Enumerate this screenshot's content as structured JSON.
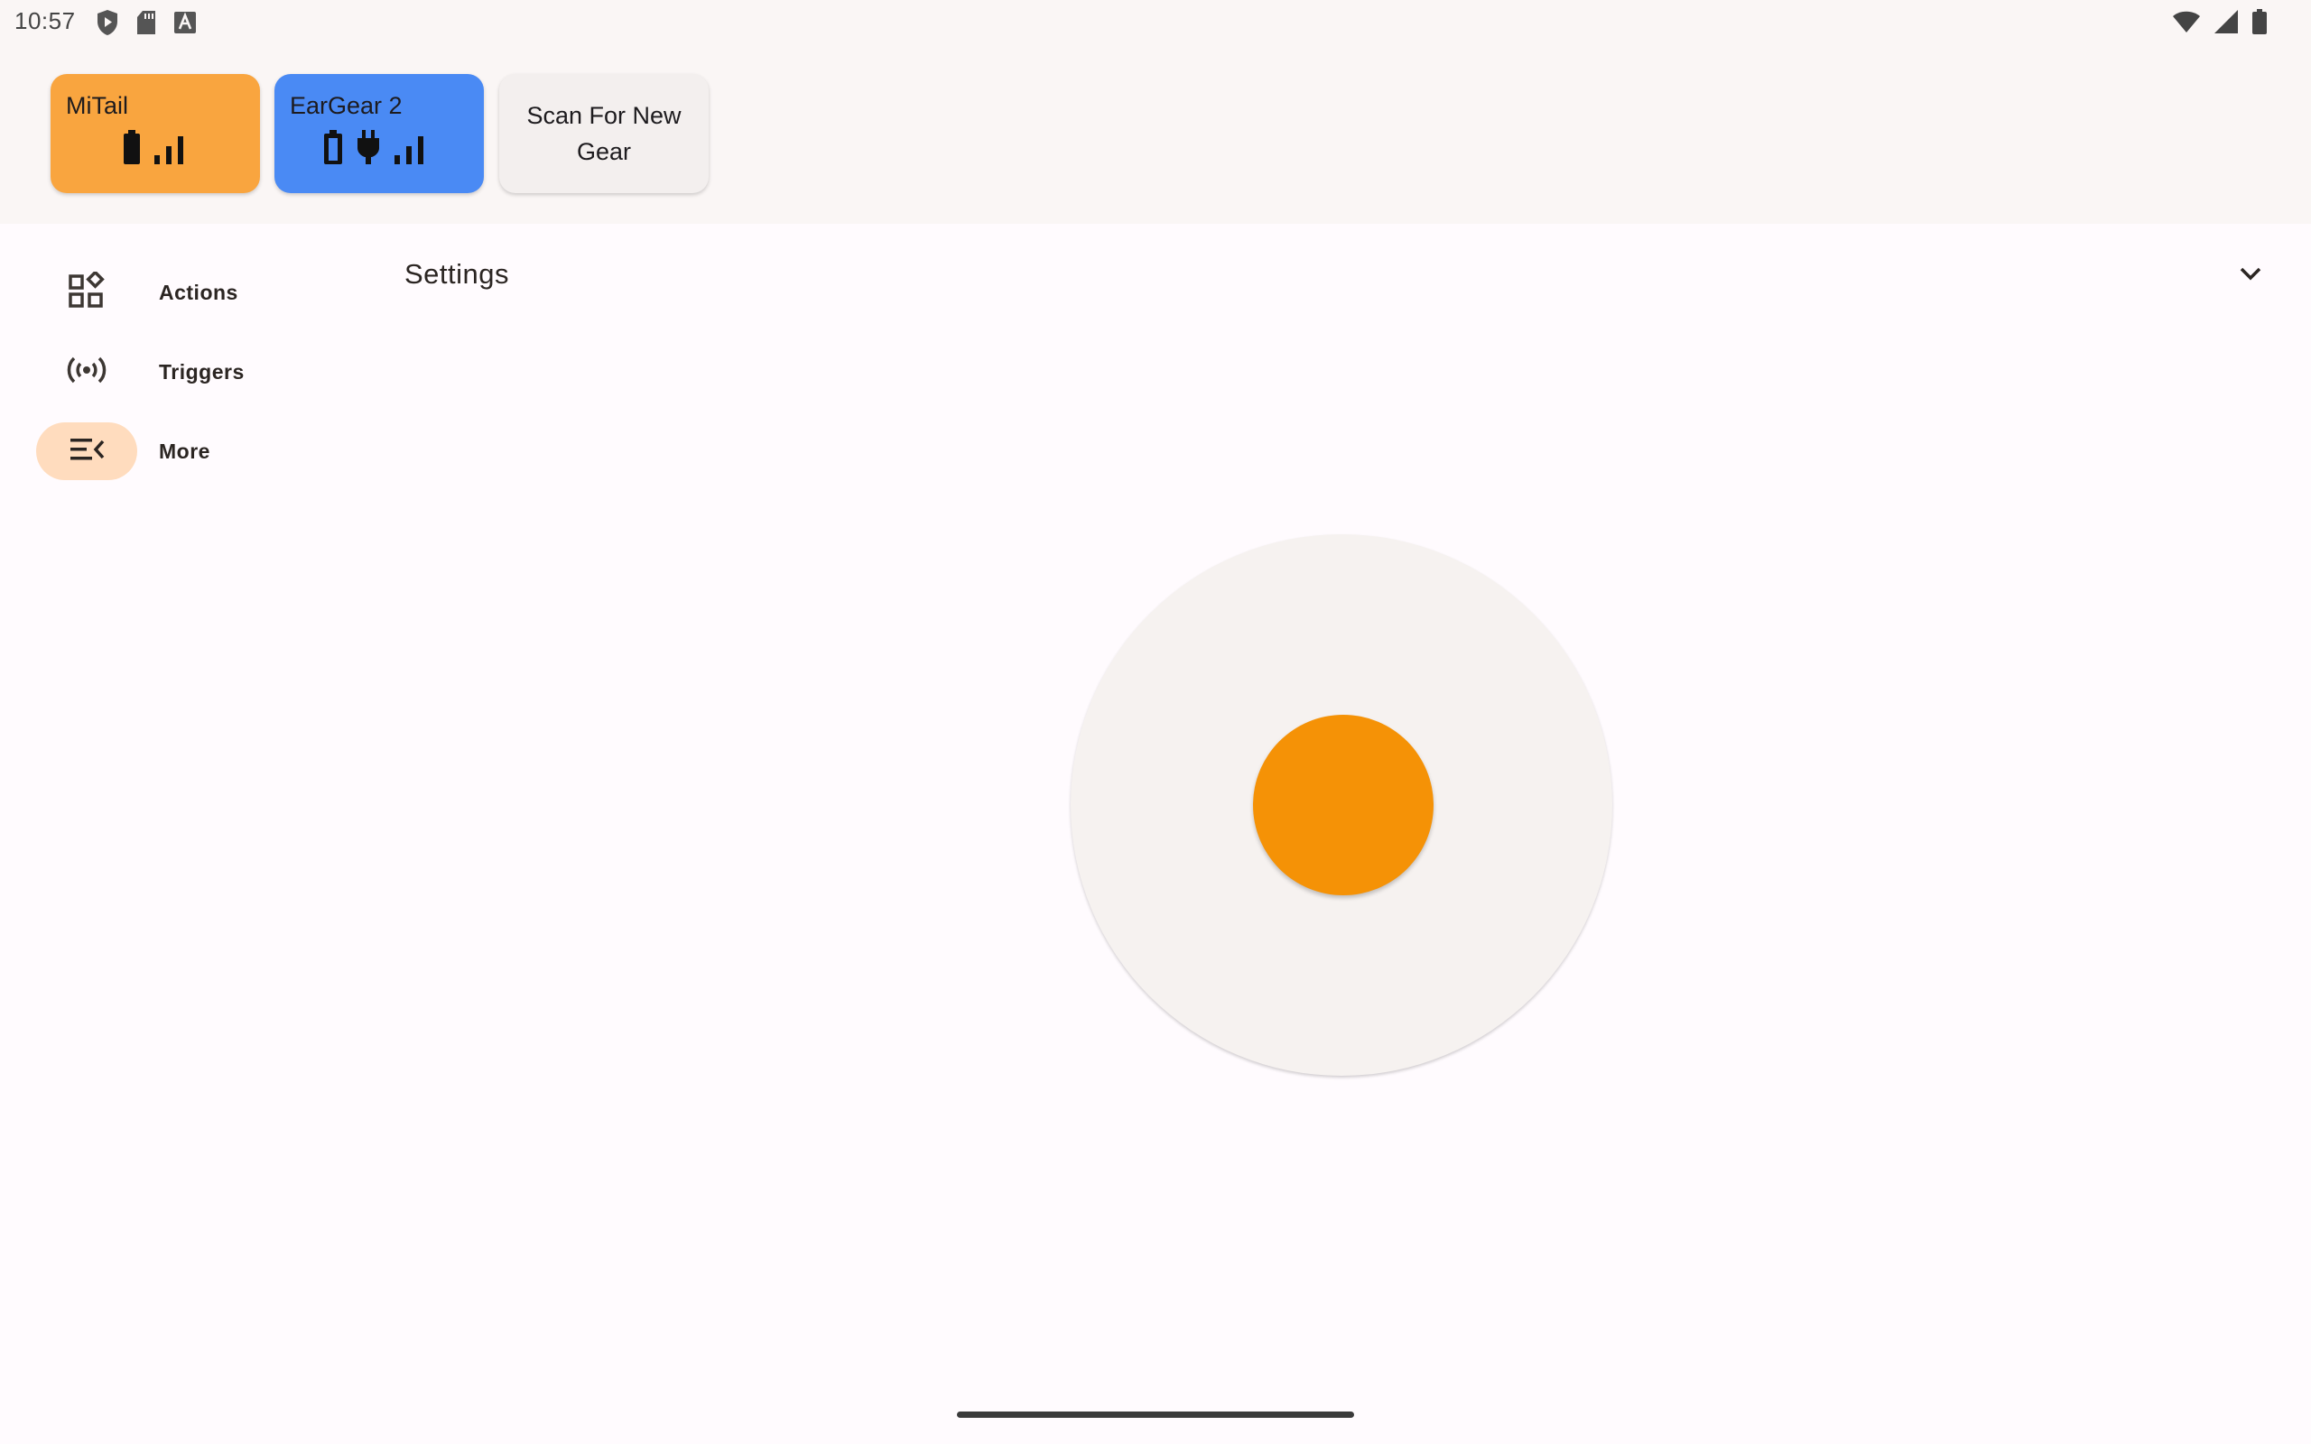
{
  "status_bar": {
    "time": "10:57",
    "left_icons": [
      "shield-play-icon",
      "sd-card-icon",
      "font-a-icon"
    ],
    "right_icons": [
      "wifi-icon",
      "cell-signal-icon",
      "battery-icon"
    ]
  },
  "gear": [
    {
      "name": "MiTail",
      "color": "#f9a53f",
      "icons": [
        "battery-icon",
        "signal-bars-icon"
      ]
    },
    {
      "name": "EarGear 2",
      "color": "#4a8af4",
      "icons": [
        "battery-icon",
        "charging-plug-icon",
        "signal-bars-icon"
      ]
    }
  ],
  "scan_button": {
    "label": "Scan For New Gear"
  },
  "nav": {
    "items": [
      {
        "label": "Actions",
        "icon": "widgets-icon",
        "active": false
      },
      {
        "label": "Triggers",
        "icon": "sensors-icon",
        "active": false
      },
      {
        "label": "More",
        "icon": "menu-open-icon",
        "active": true
      }
    ]
  },
  "main": {
    "section_title": "Settings",
    "joystick": {
      "knob_color": "#f59206"
    }
  },
  "colors": {
    "background": "#fffbfe",
    "surface": "#faf6f5",
    "nav_active": "#ffdcbe"
  }
}
